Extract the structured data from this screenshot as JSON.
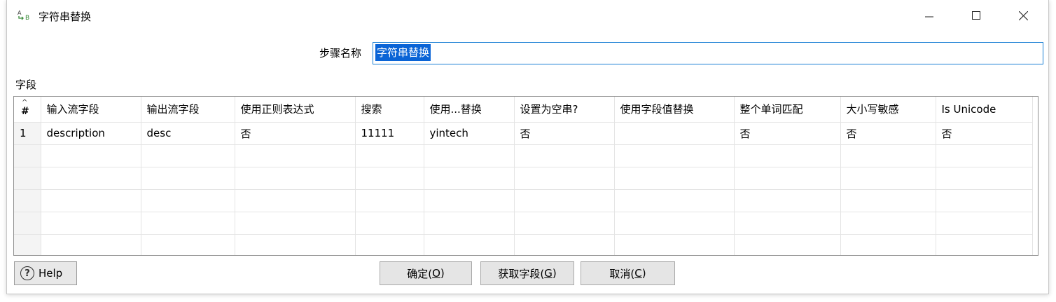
{
  "window": {
    "title": "字符串替换",
    "icon": "abc-replace-icon"
  },
  "step": {
    "label": "步骤名称",
    "value": "字符串替换"
  },
  "fields": {
    "label": "字段",
    "columns": [
      "#",
      "输入流字段",
      "输出流字段",
      "使用正则表达式",
      "搜索",
      "使用...替换",
      "设置为空串?",
      "使用字段值替换",
      "整个单词匹配",
      "大小写敏感",
      "Is Unicode"
    ],
    "rows": [
      [
        "1",
        "description",
        "desc",
        "否",
        "11111",
        "yintech",
        "否",
        "",
        "否",
        "否",
        "否"
      ],
      [
        "",
        "",
        "",
        "",
        "",
        "",
        "",
        "",
        "",
        "",
        ""
      ],
      [
        "",
        "",
        "",
        "",
        "",
        "",
        "",
        "",
        "",
        "",
        ""
      ],
      [
        "",
        "",
        "",
        "",
        "",
        "",
        "",
        "",
        "",
        "",
        ""
      ],
      [
        "",
        "",
        "",
        "",
        "",
        "",
        "",
        "",
        "",
        "",
        ""
      ],
      [
        "",
        "",
        "",
        "",
        "",
        "",
        "",
        "",
        "",
        "",
        ""
      ]
    ]
  },
  "buttons": {
    "help": "Help",
    "ok_text": "确定(",
    "ok_key": "O",
    "ok_end": ")",
    "get_text": "获取字段(",
    "get_key": "G",
    "get_end": ")",
    "cancel_text": "取消(",
    "cancel_key": "C",
    "cancel_end": ")"
  },
  "colors": {
    "selection": "#0a64d6",
    "focus_border": "#1b7fd4"
  }
}
